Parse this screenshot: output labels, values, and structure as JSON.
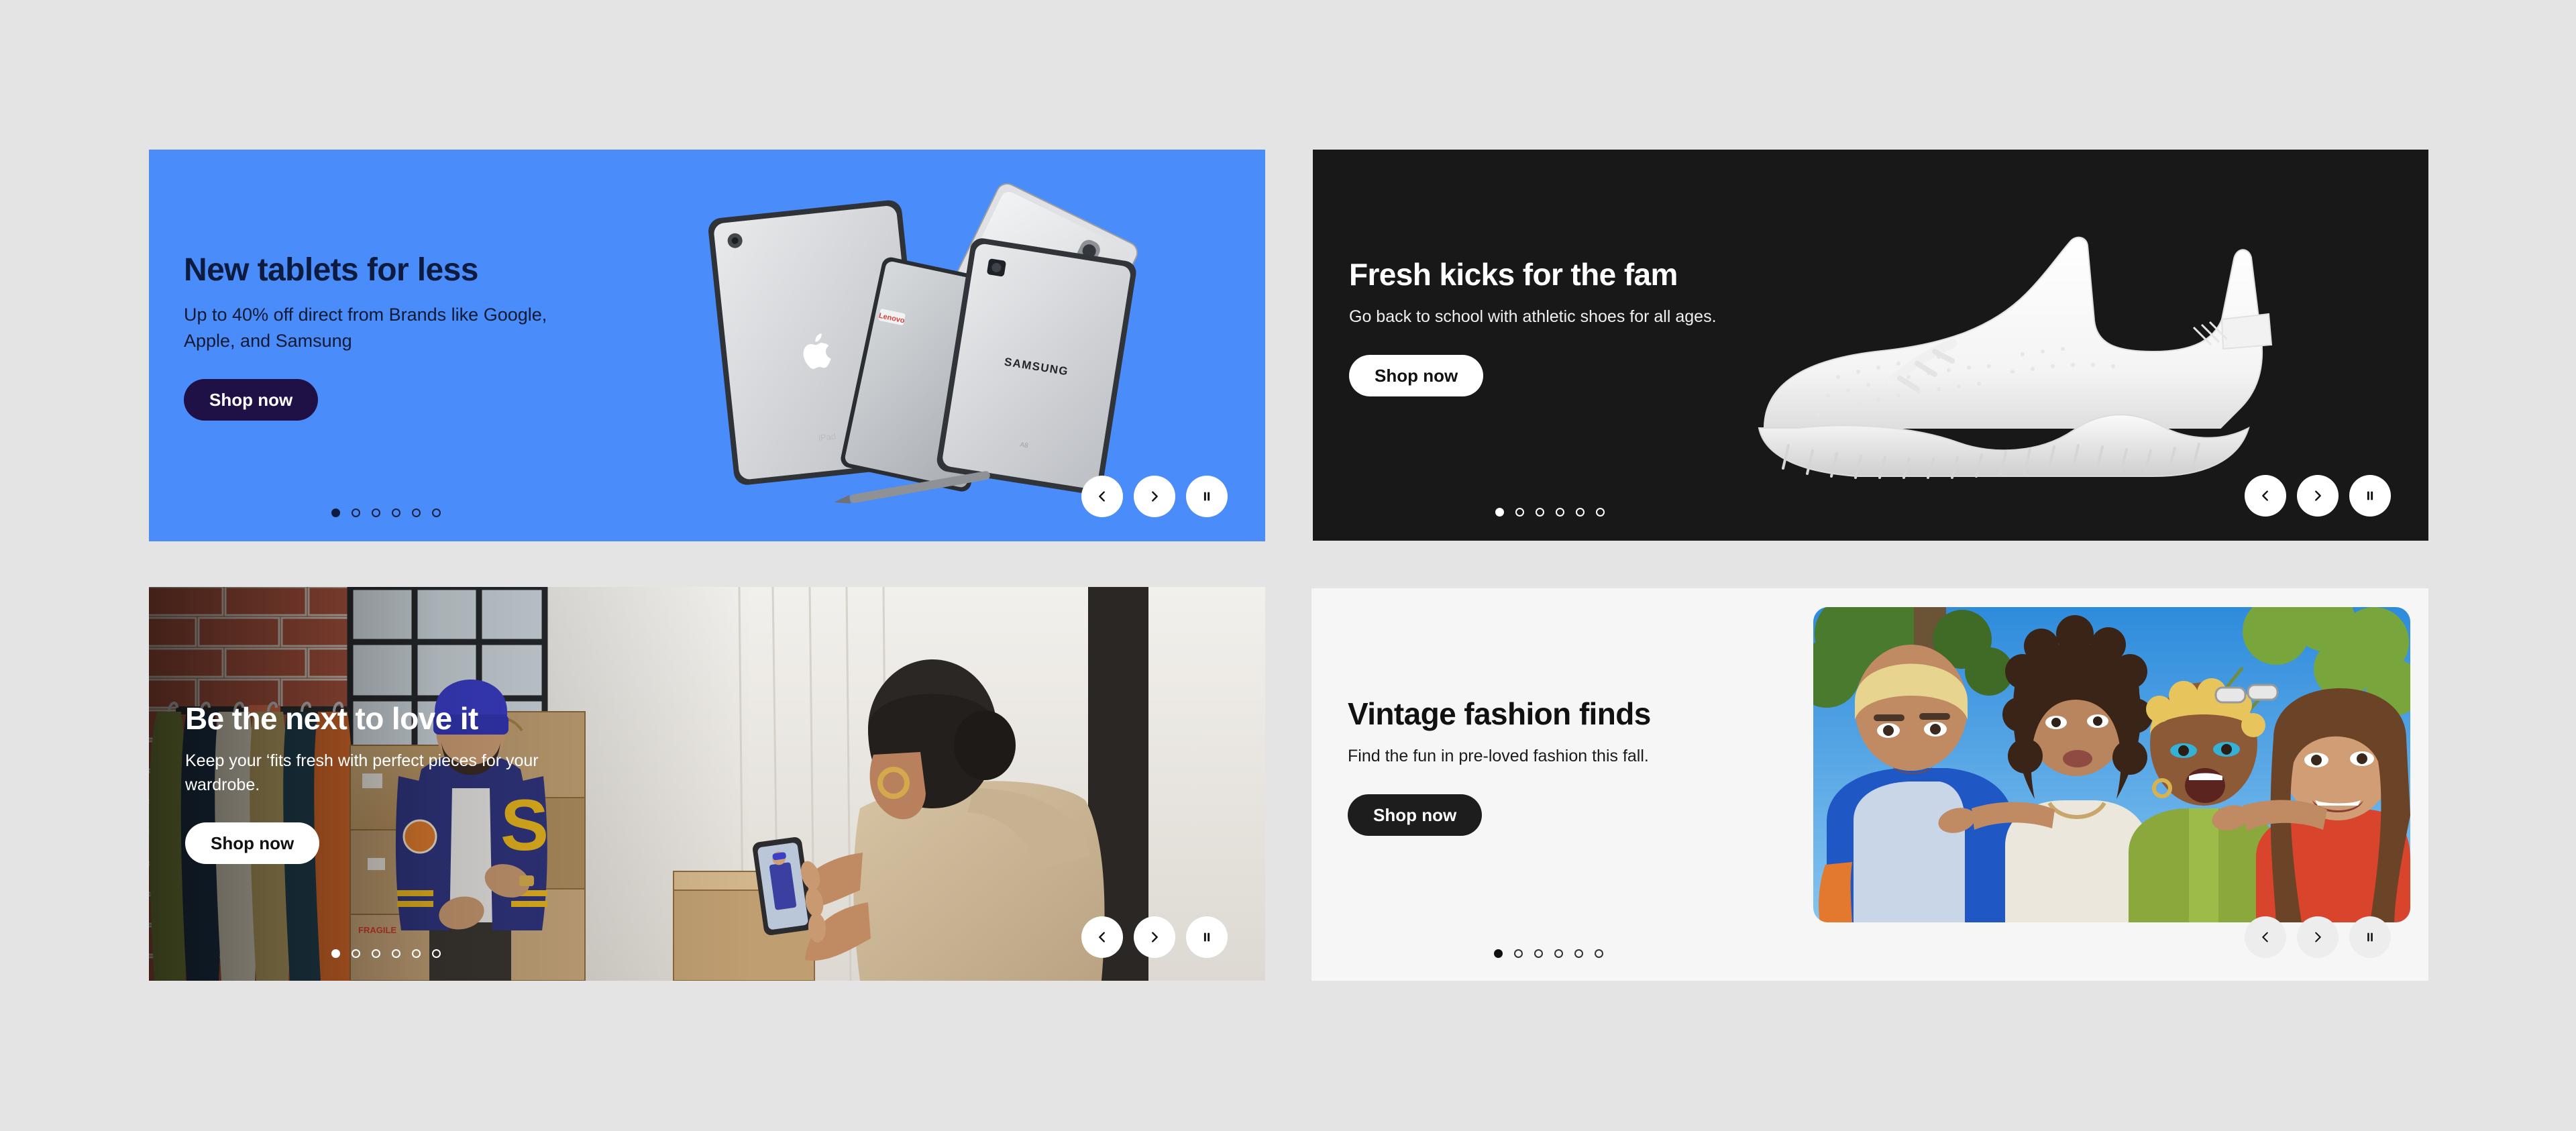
{
  "page": {
    "background_color": "#e4e4e4",
    "layout": "2x2 grid of promotional carousel banner cards"
  },
  "cards": [
    {
      "id": "tablets",
      "headline": "New tablets for less",
      "subcopy": "Up to 40% off direct from Brands like Google, Apple, and Samsung",
      "cta_label": "Shop now",
      "background_color": "#4a8cfa",
      "text_color": "#0d1b3e",
      "cta_background": "#1f1046",
      "cta_text_color": "#ffffff",
      "image_alt": "Three tablets — Apple iPad, Lenovo tablet and Samsung Galaxy Tab with stylus",
      "carousel": {
        "total_slides": 6,
        "active_slide": 1,
        "prev_label": "Previous slide",
        "next_label": "Next slide",
        "pause_label": "Pause carousel",
        "prev_icon": "chevron-left-icon",
        "next_icon": "chevron-right-icon",
        "pause_icon": "pause-icon"
      }
    },
    {
      "id": "kicks",
      "headline": "Fresh kicks for the fam",
      "subcopy": "Go back to school with athletic shoes for all ages.",
      "cta_label": "Shop now",
      "background_color": "#181818",
      "text_color": "#ffffff",
      "cta_background": "#ffffff",
      "cta_text_color": "#111111",
      "image_alt": "White knit athletic sneaker on black background",
      "carousel": {
        "total_slides": 6,
        "active_slide": 1,
        "prev_label": "Previous slide",
        "next_label": "Next slide",
        "pause_label": "Pause carousel",
        "prev_icon": "chevron-left-icon",
        "next_icon": "chevron-right-icon",
        "pause_icon": "pause-icon"
      }
    },
    {
      "id": "loveit",
      "headline": "Be the next to love it",
      "subcopy": "Keep your ‘fits fresh with perfect pieces for your wardrobe.",
      "cta_label": "Shop now",
      "background_color": "#3a3530",
      "text_color": "#ffffff",
      "cta_background": "#ffffff",
      "cta_text_color": "#111111",
      "image_alt": "Man in blue varsity jacket being photographed by woman with phone among cardboard boxes and a clothing rack against a brick wall",
      "carousel": {
        "total_slides": 6,
        "active_slide": 1,
        "prev_label": "Previous slide",
        "next_label": "Next slide",
        "pause_label": "Pause carousel",
        "prev_icon": "chevron-left-icon",
        "next_icon": "chevron-right-icon",
        "pause_icon": "pause-icon"
      }
    },
    {
      "id": "vintage",
      "headline": "Vintage fashion finds",
      "subcopy": "Find the fun in pre-loved fashion this fall.",
      "cta_label": "Shop now",
      "background_color": "#f6f6f6",
      "text_color": "#111111",
      "cta_background": "#1d1d1d",
      "cta_text_color": "#ffffff",
      "image_alt": "Four smiling friends outdoors in colorful vintage clothing under a blue sky",
      "carousel": {
        "total_slides": 6,
        "active_slide": 1,
        "prev_label": "Previous slide",
        "next_label": "Next slide",
        "pause_label": "Pause carousel",
        "prev_icon": "chevron-left-icon",
        "next_icon": "chevron-right-icon",
        "pause_icon": "pause-icon"
      }
    }
  ]
}
